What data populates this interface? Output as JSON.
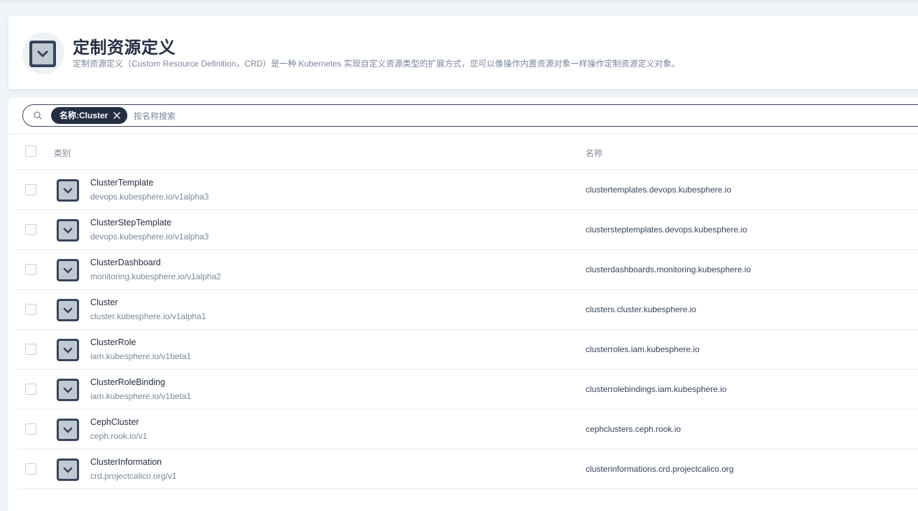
{
  "header": {
    "title": "定制资源定义",
    "description": "定制资源定义（Custom Resource Definition，CRD）是一种 Kubernetes 实现自定义资源类型的扩展方式，您可以像操作内置资源对象一样操作定制资源定义对象。",
    "icon": "crd-icon"
  },
  "search": {
    "filter_tag": "名称:Cluster",
    "placeholder": "按名称搜索"
  },
  "table": {
    "columns": {
      "type": "类别",
      "name": "名称"
    },
    "rows": [
      {
        "kind": "ClusterTemplate",
        "group": "devops.kubesphere.io/v1alpha3",
        "name": "clustertemplates.devops.kubesphere.io"
      },
      {
        "kind": "ClusterStepTemplate",
        "group": "devops.kubesphere.io/v1alpha3",
        "name": "clustersteptemplates.devops.kubesphere.io"
      },
      {
        "kind": "ClusterDashboard",
        "group": "monitoring.kubesphere.io/v1alpha2",
        "name": "clusterdashboards.monitoring.kubesphere.io"
      },
      {
        "kind": "Cluster",
        "group": "cluster.kubesphere.io/v1alpha1",
        "name": "clusters.cluster.kubesphere.io"
      },
      {
        "kind": "ClusterRole",
        "group": "iam.kubesphere.io/v1beta1",
        "name": "clusterroles.iam.kubesphere.io"
      },
      {
        "kind": "ClusterRoleBinding",
        "group": "iam.kubesphere.io/v1beta1",
        "name": "clusterrolebindings.iam.kubesphere.io"
      },
      {
        "kind": "CephCluster",
        "group": "ceph.rook.io/v1",
        "name": "cephclusters.ceph.rook.io"
      },
      {
        "kind": "ClusterInformation",
        "group": "crd.projectcalico.org/v1",
        "name": "clusterinformations.crd.projectcalico.org"
      }
    ]
  },
  "colors": {
    "icon_dark": "#36435c",
    "icon_light": "#c1c9d1",
    "text_primary": "#242e42",
    "text_secondary": "#79879c"
  }
}
